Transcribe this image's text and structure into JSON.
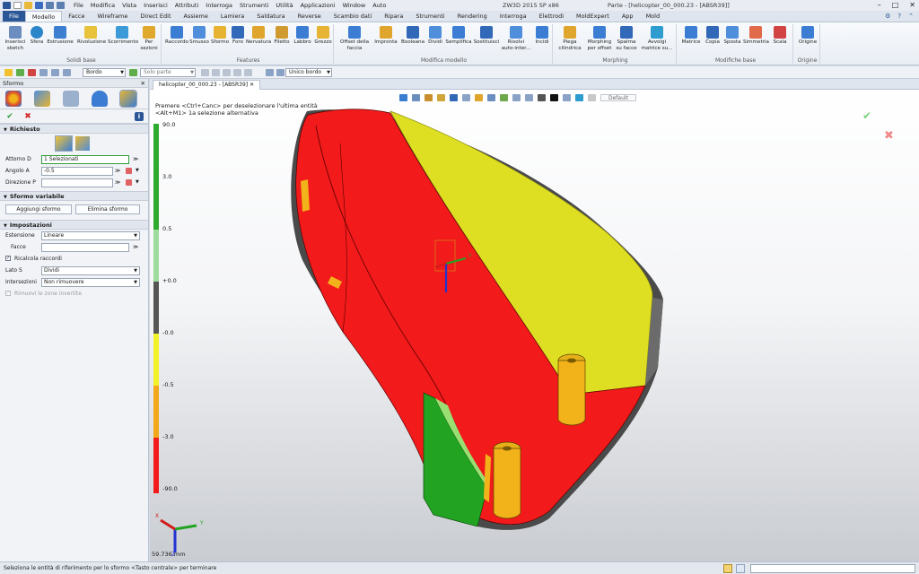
{
  "window": {
    "app_title": "ZW3D 2015 SP x86",
    "doc_title": "Parte - [helicopter_00_000.23 - [ABSR39]]",
    "menu": [
      "File",
      "Modifica",
      "Vista",
      "Inserisci",
      "Attributi",
      "Interroga",
      "Strumenti",
      "Utilità",
      "Applicazioni",
      "Window",
      "Auto"
    ]
  },
  "ribbon_tabs": [
    "File",
    "Modello",
    "Facce",
    "Wireframe",
    "Direct Edit",
    "Assieme",
    "Lamiera",
    "Saldatura",
    "Reverse",
    "Scambio dati",
    "Ripara",
    "Strumenti",
    "Rendering",
    "Interroga",
    "Elettrodi",
    "MoldExpert",
    "App",
    "Mold"
  ],
  "ribbon_groups": {
    "solidi_base": {
      "label": "Solidi base",
      "buttons": [
        "Inserisci sketch",
        "Sfera",
        "Estrusione",
        "Rivoluzione",
        "Scorrimento",
        "Per sezioni"
      ]
    },
    "features": {
      "label": "Features",
      "buttons": [
        "Raccordo",
        "Smusso",
        "Sformo",
        "Foro",
        "Nervatura",
        "Filetto",
        "Labbro",
        "Grezzo"
      ]
    },
    "modifica_modello": {
      "label": "Modifica modello",
      "buttons": [
        "Offset della faccia",
        "Impronta",
        "Booleana",
        "Dividi",
        "Semplifica",
        "Sostituisci",
        "Risolvi auto-inter...",
        "Incidi"
      ]
    },
    "morphing": {
      "label": "Morphing",
      "buttons": [
        "Piega cilindrica",
        "Morphing per offset",
        "Spalma su facce",
        "Avvolgi matrice su..."
      ]
    },
    "modifiche_base": {
      "label": "Modifiche base",
      "buttons": [
        "Matrice",
        "Copia",
        "Sposta",
        "Simmetria",
        "Scala"
      ]
    },
    "origine": {
      "label": "Origine",
      "buttons": [
        "Origine"
      ]
    }
  },
  "toolbar2": {
    "filter1": "Bordo",
    "filter2": "Solo parte",
    "filter3": "Unico bordo"
  },
  "panel": {
    "title": "Sformo",
    "sections": {
      "richiesto": "Richiesto",
      "sformo_variabile": "Sformo variabile",
      "impostazioni": "Impostazioni"
    },
    "fields": {
      "attorno_label": "Attorno D",
      "attorno_value": "1 Selezionati",
      "angolo_label": "Angolo A",
      "angolo_value": "-0.5",
      "direzione_label": "Direzione P",
      "direzione_value": "",
      "estensione_label": "Estensione",
      "estensione_value": "Lineare",
      "facce_label": "Facce",
      "facce_value": "",
      "ricalcola_label": "Ricalcola raccordi",
      "lato_label": "Lato S",
      "lato_value": "Dividi",
      "intersezioni_label": "Intersezioni",
      "intersezioni_value": "Non rimuovere",
      "rimuovi_label": "Rimuovi le zone invertite"
    },
    "buttons": {
      "aggiungi": "Aggiungi sformo",
      "elimina": "Elimina sformo"
    }
  },
  "document_tab": "helicopter_00_000.23 - [ABSR39]",
  "viewport": {
    "hint_line1": "Premere <Ctrl+Canc> per deselezionare l'ultima entità",
    "hint_line2": "<Alt+M1> 1a selezione alternativa",
    "style_box": "Default",
    "scale_text": "59.736 mm",
    "axis_x": "X",
    "axis_y": "Y",
    "axis_z": "Z",
    "legend_labels": [
      "90.0",
      "3.0",
      "0.5",
      "+0.0",
      "-0.0",
      "-0.5",
      "-3.0",
      "-90.0"
    ]
  },
  "colors": {
    "draft_red": "#f21a1a",
    "draft_yellow": "#e1e224",
    "draft_green": "#33b833",
    "draft_orange": "#f2b21a",
    "accent": "#2b5797"
  },
  "status": {
    "text": "Seleziona le entità di riferimento per lo sformo  <Tasto centrale> per terminare"
  }
}
